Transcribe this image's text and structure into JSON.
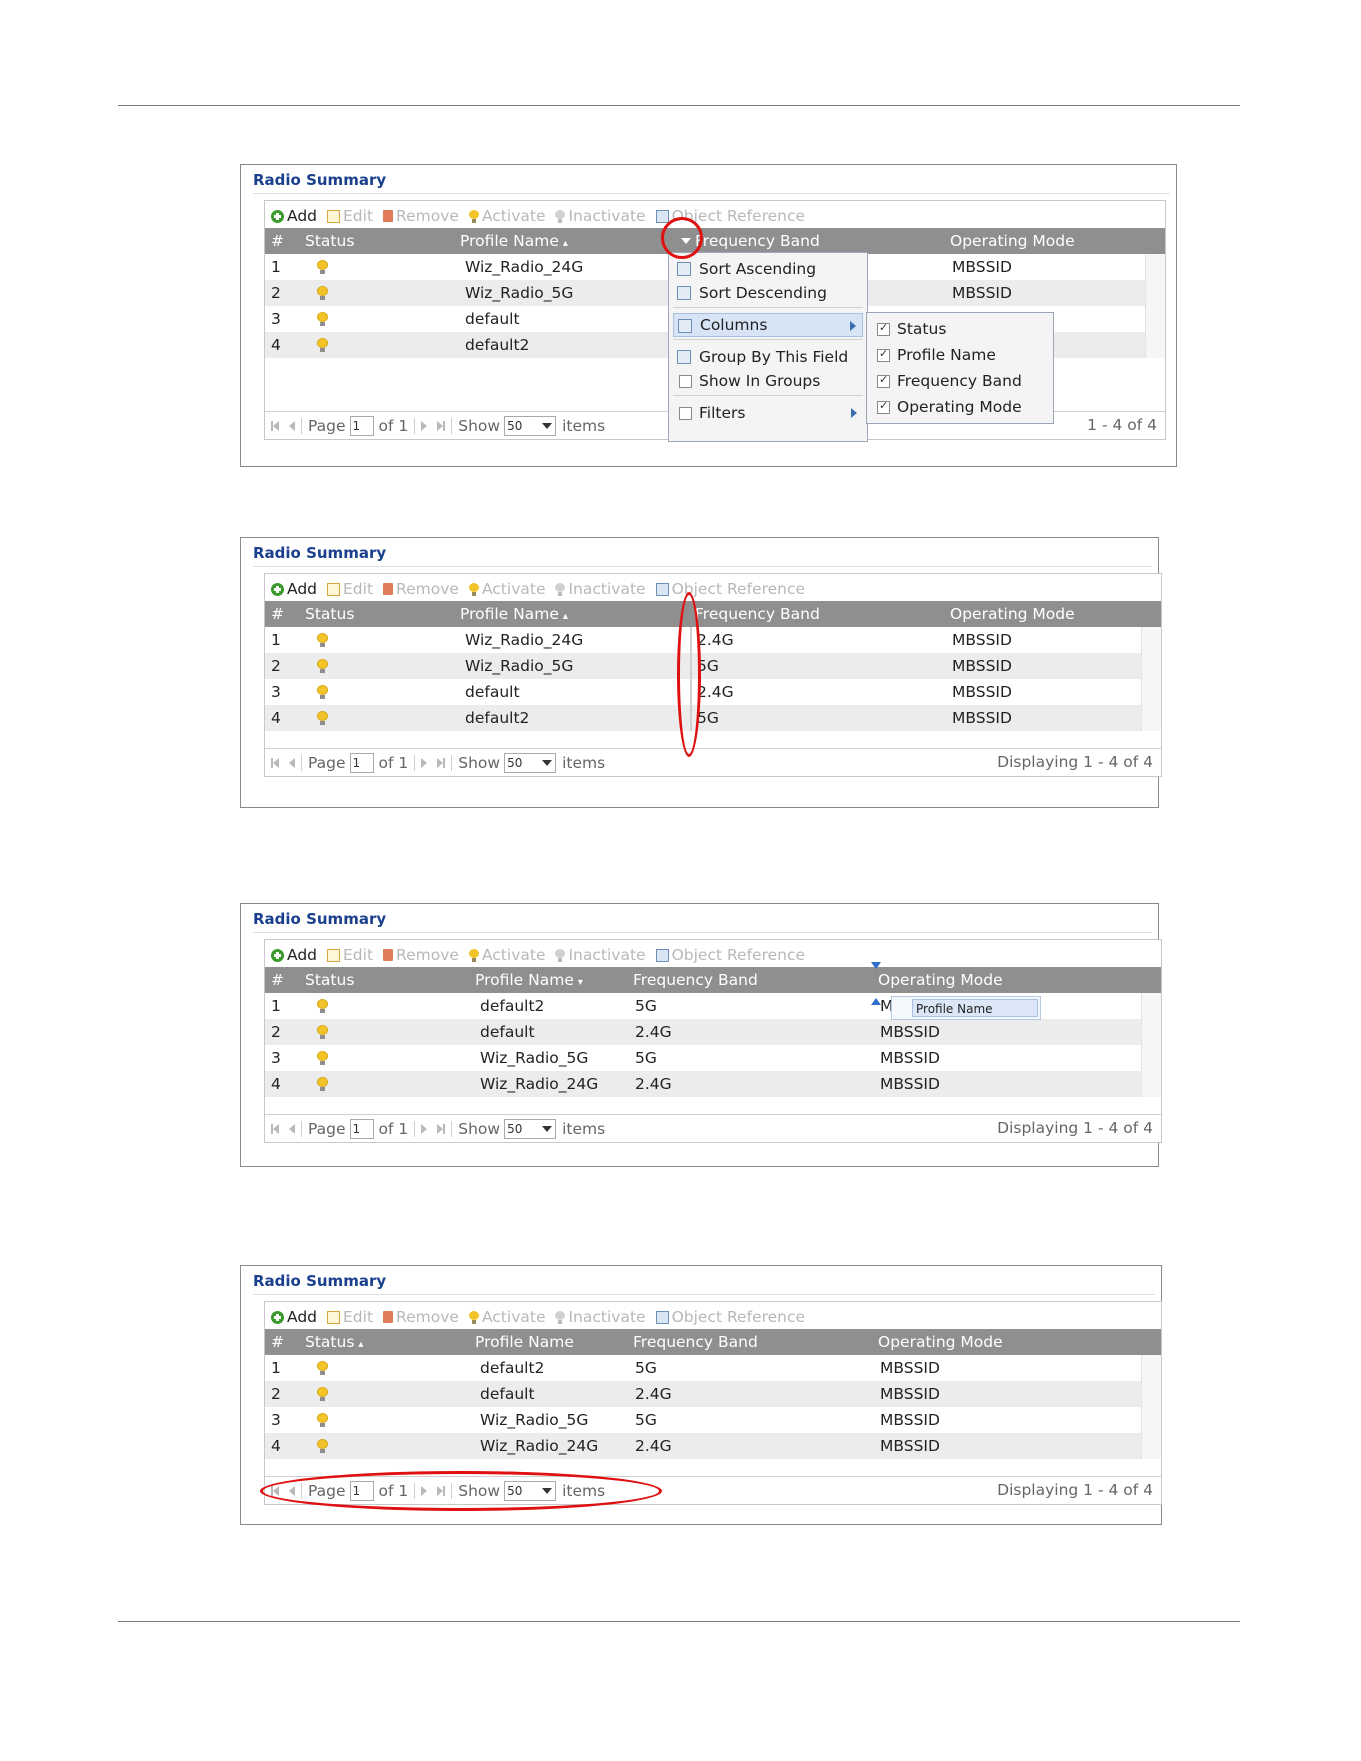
{
  "panels": [
    {
      "title": "Radio Summary",
      "toolbar": {
        "add": "Add",
        "edit": "Edit",
        "remove": "Remove",
        "activate": "Activate",
        "inactivate": "Inactivate",
        "object_reference": "Object Reference"
      },
      "headers": {
        "num": "#",
        "status": "Status",
        "profile": "Profile Name",
        "profile_sort": "▴",
        "status_sort": "",
        "freq": "Frequency Band",
        "mode": "Operating Mode"
      },
      "rows": [
        {
          "num": "1",
          "profile": "Wiz_Radio_24G",
          "freq": "",
          "mode": "MBSSID"
        },
        {
          "num": "2",
          "profile": "Wiz_Radio_5G",
          "freq": "",
          "mode": "MBSSID"
        },
        {
          "num": "3",
          "profile": "default",
          "freq": "",
          "mode": ""
        },
        {
          "num": "4",
          "profile": "default2",
          "freq": "",
          "mode": ""
        }
      ],
      "pager": {
        "page": "Page",
        "page_value": "1",
        "of": "of 1",
        "show": "Show",
        "show_value": "50",
        "items": "items",
        "display": "1 - 4 of 4"
      },
      "menu": {
        "sort_asc": "Sort Ascending",
        "sort_desc": "Sort Descending",
        "columns": "Columns",
        "group_by": "Group By This Field",
        "show_in_groups": "Show In Groups",
        "filters": "Filters"
      },
      "submenu": [
        "Status",
        "Profile Name",
        "Frequency Band",
        "Operating Mode"
      ]
    },
    {
      "title": "Radio Summary",
      "toolbar": {
        "add": "Add",
        "edit": "Edit",
        "remove": "Remove",
        "activate": "Activate",
        "inactivate": "Inactivate",
        "object_reference": "Object Reference"
      },
      "headers": {
        "num": "#",
        "status": "Status",
        "profile": "Profile Name",
        "profile_sort": "▴",
        "status_sort": "",
        "freq": "Frequency Band",
        "mode": "Operating Mode"
      },
      "rows": [
        {
          "num": "1",
          "profile": "Wiz_Radio_24G",
          "freq": "2.4G",
          "mode": "MBSSID"
        },
        {
          "num": "2",
          "profile": "Wiz_Radio_5G",
          "freq": "5G",
          "mode": "MBSSID"
        },
        {
          "num": "3",
          "profile": "default",
          "freq": "2.4G",
          "mode": "MBSSID"
        },
        {
          "num": "4",
          "profile": "default2",
          "freq": "5G",
          "mode": "MBSSID"
        }
      ],
      "pager": {
        "page": "Page",
        "page_value": "1",
        "of": "of 1",
        "show": "Show",
        "show_value": "50",
        "items": "items",
        "display": "Displaying 1 - 4 of 4"
      }
    },
    {
      "title": "Radio Summary",
      "toolbar": {
        "add": "Add",
        "edit": "Edit",
        "remove": "Remove",
        "activate": "Activate",
        "inactivate": "Inactivate",
        "object_reference": "Object Reference"
      },
      "headers": {
        "num": "#",
        "status": "Status",
        "profile": "Profile Name",
        "profile_sort": "▾",
        "status_sort": "",
        "freq": "Frequency Band",
        "mode": "Operating Mode"
      },
      "rows": [
        {
          "num": "1",
          "profile": "default2",
          "freq": "5G",
          "mode": "M"
        },
        {
          "num": "2",
          "profile": "default",
          "freq": "2.4G",
          "mode": "MBSSID"
        },
        {
          "num": "3",
          "profile": "Wiz_Radio_5G",
          "freq": "5G",
          "mode": "MBSSID"
        },
        {
          "num": "4",
          "profile": "Wiz_Radio_24G",
          "freq": "2.4G",
          "mode": "MBSSID"
        }
      ],
      "pager": {
        "page": "Page",
        "page_value": "1",
        "of": "of 1",
        "show": "Show",
        "show_value": "50",
        "items": "items",
        "display": "Displaying 1 - 4 of 4"
      },
      "drag_label": "Profile Name"
    },
    {
      "title": "Radio Summary",
      "toolbar": {
        "add": "Add",
        "edit": "Edit",
        "remove": "Remove",
        "activate": "Activate",
        "inactivate": "Inactivate",
        "object_reference": "Object Reference"
      },
      "headers": {
        "num": "#",
        "status": "Status",
        "profile": "Profile Name",
        "profile_sort": "",
        "status_sort": "▴",
        "freq": "Frequency Band",
        "mode": "Operating Mode"
      },
      "rows": [
        {
          "num": "1",
          "profile": "default2",
          "freq": "5G",
          "mode": "MBSSID"
        },
        {
          "num": "2",
          "profile": "default",
          "freq": "2.4G",
          "mode": "MBSSID"
        },
        {
          "num": "3",
          "profile": "Wiz_Radio_5G",
          "freq": "5G",
          "mode": "MBSSID"
        },
        {
          "num": "4",
          "profile": "Wiz_Radio_24G",
          "freq": "2.4G",
          "mode": "MBSSID"
        }
      ],
      "pager": {
        "page": "Page",
        "page_value": "1",
        "of": "of 1",
        "show": "Show",
        "show_value": "50",
        "items": "items",
        "display": "Displaying 1 - 4 of 4"
      }
    }
  ],
  "colors": {
    "title": "#1a3f8c",
    "header_bg": "#8f8f8f",
    "highlight_red": "#e01010",
    "bulb": "#f2c42a"
  }
}
